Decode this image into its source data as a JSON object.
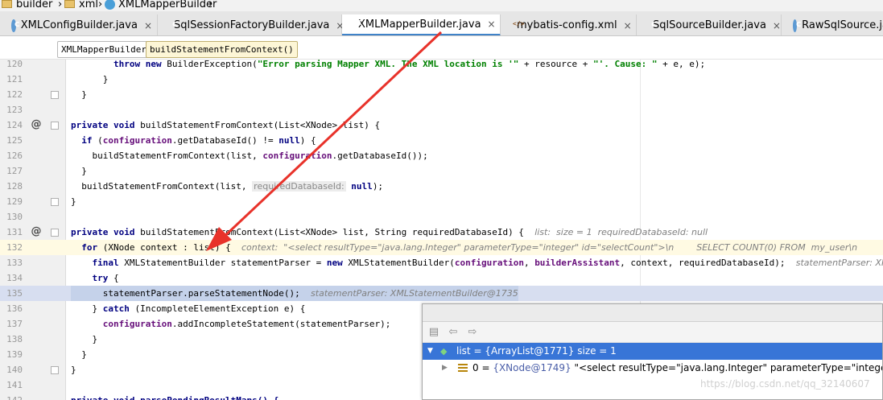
{
  "breadcrumb": [
    "builder",
    "xml",
    "XMLMapperBuilder"
  ],
  "tabs": [
    {
      "label": "XMLConfigBuilder.java",
      "icon": "class-icon"
    },
    {
      "label": "SqlSessionFactoryBuilder.java",
      "icon": "class-icon"
    },
    {
      "label": "XMLMapperBuilder.java",
      "icon": "class-icon",
      "active": true
    },
    {
      "label": "mybatis-config.xml",
      "icon": "xml-file-icon"
    },
    {
      "label": "SqlSourceBuilder.java",
      "icon": "class-icon"
    },
    {
      "label": "RawSqlSource.ja",
      "icon": "class-icon"
    }
  ],
  "tab_close": "×",
  "structure_breadcrumb": [
    "XMLMapperBuilder",
    "buildStatementFromContext()"
  ],
  "code": {
    "l120_num": "120",
    "l120_a": "        throw new",
    "l120_b": " BuilderException(",
    "l120_c": "\"Error parsing Mapper XML. The XML location is '\"",
    "l120_d": " + resource + ",
    "l120_e": "\"'. Cause: \"",
    "l120_f": " + e, e);",
    "l121_num": "121",
    "l121": "      }",
    "l122_num": "122",
    "l122": "  }",
    "l123_num": "123",
    "l124_num": "124",
    "l124_a": "private void",
    "l124_b": " buildStatementFromContext(List<XNode> list) {",
    "l125_num": "125",
    "l125_a": "  if",
    "l125_b": " (",
    "l125_c": "configuration",
    "l125_d": ".getDatabaseId() != ",
    "l125_e": "null",
    "l125_f": ") {",
    "l126_num": "126",
    "l126_a": "    buildStatementFromContext(list, ",
    "l126_b": "configuration",
    "l126_c": ".getDatabaseId());",
    "l127_num": "127",
    "l127": "  }",
    "l128_num": "128",
    "l128_a": "  buildStatementFromContext(list, ",
    "l128_hint": "requiredDatabaseId:",
    "l128_b": " null",
    "l128_c": ");",
    "l129_num": "129",
    "l129": "}",
    "l130_num": "130",
    "l131_num": "131",
    "l131_a": "private void",
    "l131_b": " buildStatementFromContext(List<XNode> list, String requiredDatabaseId) {",
    "l131_dbg": "list:  size = 1  requiredDatabaseId: null",
    "l132_num": "132",
    "l132_a": "  for",
    "l132_b": " (XNode context : list) {",
    "l132_dbg": "context:  \"<select resultType=\"java.lang.Integer\" parameterType=\"integer\" id=\"selectCount\">\\n        SELECT COUNT(0) FROM  my_user\\n",
    "l133_num": "133",
    "l133_a": "    final",
    "l133_b": " XMLStatementBuilder statementParser = ",
    "l133_c": "new",
    "l133_d": " XMLStatementBuilder(",
    "l133_e": "configuration",
    "l133_f": ", ",
    "l133_g": "builderAssistant",
    "l133_h": ", context, requiredDatabaseId);",
    "l133_dbg": "statementParser: XMLStatem",
    "l134_num": "134",
    "l134_a": "    try",
    "l134_b": " {",
    "l135_num": "135",
    "l135_a": "      statementParser.parseStatementNode();",
    "l135_dbg": "statementParser: XMLStatementBuilder@1735",
    "l136_num": "136",
    "l136_a": "    } ",
    "l136_b": "catch",
    "l136_c": " (IncompleteElementException e) {",
    "l137_num": "137",
    "l137_a": "      configuration",
    "l137_b": ".addIncompleteStatement(statementParser);",
    "l138_num": "138",
    "l138": "    }",
    "l139_num": "139",
    "l139": "  }",
    "l140_num": "140",
    "l140": "}",
    "l141_num": "141",
    "l142_num": "142",
    "l142": "private void parsePendingResultMaps() {"
  },
  "popup": {
    "row1_name": "list",
    "row1_value": " = {ArrayList@1771}  size = 1",
    "row2_name": "0",
    "row2_eq": " = ",
    "row2_ref": "{XNode@1749}",
    "row2_value": " \"<select resultType=\"java.lang.Integer\" parameterType=\"integer\" id"
  },
  "watermark": "https://blog.csdn.net/qq_32140607",
  "colors": {
    "keyword": "#000080",
    "string": "#008000",
    "field": "#660e7a",
    "exec_line": "#d7def0",
    "selection": "#3875d7",
    "arrow": "#e8322a"
  }
}
